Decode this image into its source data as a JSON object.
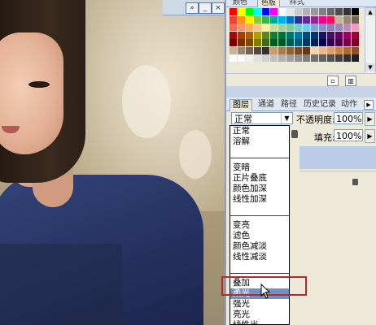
{
  "canvas": {
    "description_icon": "photo-canvas"
  },
  "topbar": {
    "icons": [
      "expand-icon",
      "minimize-icon",
      "close-icon"
    ]
  },
  "swatches": {
    "tabs": [
      "颜色",
      "色板",
      "样式"
    ],
    "active_tab": 1,
    "rows": [
      [
        "#ff0000",
        "#ffff00",
        "#00ff00",
        "#00ffff",
        "#0000ff",
        "#ff00ff",
        "#ffffff",
        "#e6e6e6",
        "#cccccc",
        "#b3b3b3",
        "#999999",
        "#808080",
        "#666666",
        "#4d4d4d",
        "#333333",
        "#000000"
      ],
      [
        "#ef4136",
        "#f7941d",
        "#fff200",
        "#8dc63f",
        "#39b54a",
        "#00a99d",
        "#00aeef",
        "#0072bc",
        "#2e3192",
        "#662d91",
        "#92278f",
        "#ec008c",
        "#ed145b",
        "#c2b59b",
        "#998675",
        "#736357"
      ],
      [
        "#f26c4f",
        "#f69679",
        "#fbaf5d",
        "#fdc689",
        "#fff799",
        "#c4df9b",
        "#a3d39c",
        "#82ca9c",
        "#7accc8",
        "#6dcff6",
        "#7da7d9",
        "#8393ca",
        "#8781bd",
        "#a186be",
        "#bd8cbf",
        "#f49ac1"
      ],
      [
        "#9e0b0f",
        "#a0410d",
        "#a36209",
        "#aba000",
        "#598527",
        "#197b30",
        "#007236",
        "#00746b",
        "#0076a3",
        "#004b80",
        "#003471",
        "#1b1464",
        "#440e62",
        "#630460",
        "#9e005d",
        "#9e0039"
      ],
      [
        "#790000",
        "#7b2e00",
        "#7d4900",
        "#827b00",
        "#406618",
        "#005e20",
        "#005826",
        "#005952",
        "#005b7f",
        "#003663",
        "#002157",
        "#0d004c",
        "#32004b",
        "#4b0049",
        "#7b0046",
        "#7a0026"
      ],
      [
        "#c7b299",
        "#998675",
        "#736357",
        "#534741",
        "#37302d",
        "#c69c6d",
        "#a67c52",
        "#8c6239",
        "#754c24",
        "#603913",
        "#f5d5b8",
        "#e6b88c",
        "#d99f6e",
        "#c4844c",
        "#a86a37",
        "#8a5228"
      ],
      [
        "#ffffff",
        "#fafafa",
        "#f0f0f0",
        "#e0e0e0",
        "#d0d0d0",
        "#c0c0c0",
        "#b0b0b0",
        "#a0a0a0",
        "#909090",
        "#808080",
        "#707070",
        "#606060",
        "#505050",
        "#404040",
        "#303030",
        "#202020"
      ]
    ],
    "bottom_icons": [
      "new-swatch-icon",
      "trash-icon"
    ]
  },
  "layers": {
    "tabs": [
      "图层",
      "通道",
      "路径",
      "历史记录",
      "动作"
    ],
    "active_tab": 0,
    "blend_mode": "正常",
    "opacity_label": "不透明度:",
    "opacity_value": "100%",
    "fill_label": "填充:",
    "fill_value": "100%"
  },
  "dropdown": {
    "groups": [
      [
        "正常",
        "溶解"
      ],
      [
        "变暗",
        "正片叠底",
        "颜色加深",
        "线性加深"
      ],
      [
        "变亮",
        "滤色",
        "颜色减淡",
        "线性减淡"
      ],
      [
        "叠加",
        "柔光",
        "强光",
        "亮光",
        "线性光"
      ]
    ],
    "highlighted": "柔光"
  }
}
